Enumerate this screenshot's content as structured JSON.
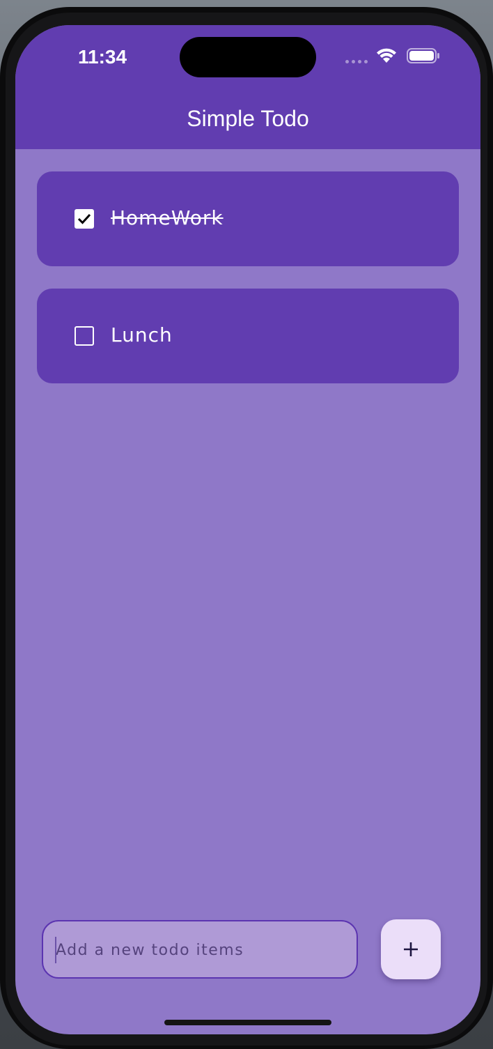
{
  "status_bar": {
    "time": "11:34"
  },
  "app_bar": {
    "title": "Simple Todo"
  },
  "todos": [
    {
      "label": "HomeWork",
      "done": true
    },
    {
      "label": "Lunch",
      "done": false
    }
  ],
  "input": {
    "placeholder": "Add a new todo items",
    "value": ""
  },
  "icons": {
    "wifi": "wifi-icon",
    "battery": "battery-icon",
    "checkbox_checked": "check-icon",
    "add": "plus-icon"
  },
  "colors": {
    "app_bar": "#613db0",
    "background": "#8f78c8",
    "card": "#613db0",
    "input_fill": "#af9ad6",
    "add_button": "#ebdef9"
  }
}
